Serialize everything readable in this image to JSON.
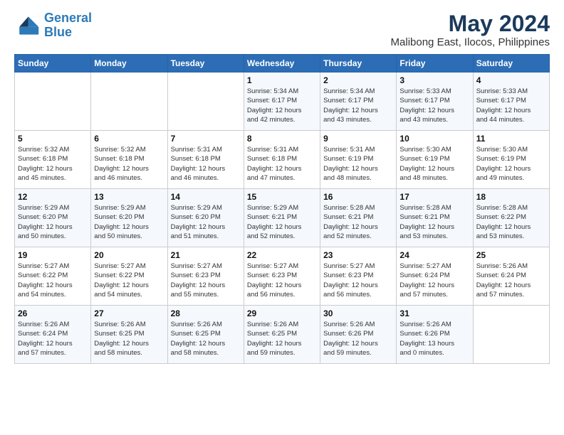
{
  "logo": {
    "line1": "General",
    "line2": "Blue"
  },
  "title": "May 2024",
  "subtitle": "Malibong East, Ilocos, Philippines",
  "weekdays": [
    "Sunday",
    "Monday",
    "Tuesday",
    "Wednesday",
    "Thursday",
    "Friday",
    "Saturday"
  ],
  "weeks": [
    [
      {
        "day": "",
        "info": ""
      },
      {
        "day": "",
        "info": ""
      },
      {
        "day": "",
        "info": ""
      },
      {
        "day": "1",
        "info": "Sunrise: 5:34 AM\nSunset: 6:17 PM\nDaylight: 12 hours\nand 42 minutes."
      },
      {
        "day": "2",
        "info": "Sunrise: 5:34 AM\nSunset: 6:17 PM\nDaylight: 12 hours\nand 43 minutes."
      },
      {
        "day": "3",
        "info": "Sunrise: 5:33 AM\nSunset: 6:17 PM\nDaylight: 12 hours\nand 43 minutes."
      },
      {
        "day": "4",
        "info": "Sunrise: 5:33 AM\nSunset: 6:17 PM\nDaylight: 12 hours\nand 44 minutes."
      }
    ],
    [
      {
        "day": "5",
        "info": "Sunrise: 5:32 AM\nSunset: 6:18 PM\nDaylight: 12 hours\nand 45 minutes."
      },
      {
        "day": "6",
        "info": "Sunrise: 5:32 AM\nSunset: 6:18 PM\nDaylight: 12 hours\nand 46 minutes."
      },
      {
        "day": "7",
        "info": "Sunrise: 5:31 AM\nSunset: 6:18 PM\nDaylight: 12 hours\nand 46 minutes."
      },
      {
        "day": "8",
        "info": "Sunrise: 5:31 AM\nSunset: 6:18 PM\nDaylight: 12 hours\nand 47 minutes."
      },
      {
        "day": "9",
        "info": "Sunrise: 5:31 AM\nSunset: 6:19 PM\nDaylight: 12 hours\nand 48 minutes."
      },
      {
        "day": "10",
        "info": "Sunrise: 5:30 AM\nSunset: 6:19 PM\nDaylight: 12 hours\nand 48 minutes."
      },
      {
        "day": "11",
        "info": "Sunrise: 5:30 AM\nSunset: 6:19 PM\nDaylight: 12 hours\nand 49 minutes."
      }
    ],
    [
      {
        "day": "12",
        "info": "Sunrise: 5:29 AM\nSunset: 6:20 PM\nDaylight: 12 hours\nand 50 minutes."
      },
      {
        "day": "13",
        "info": "Sunrise: 5:29 AM\nSunset: 6:20 PM\nDaylight: 12 hours\nand 50 minutes."
      },
      {
        "day": "14",
        "info": "Sunrise: 5:29 AM\nSunset: 6:20 PM\nDaylight: 12 hours\nand 51 minutes."
      },
      {
        "day": "15",
        "info": "Sunrise: 5:29 AM\nSunset: 6:21 PM\nDaylight: 12 hours\nand 52 minutes."
      },
      {
        "day": "16",
        "info": "Sunrise: 5:28 AM\nSunset: 6:21 PM\nDaylight: 12 hours\nand 52 minutes."
      },
      {
        "day": "17",
        "info": "Sunrise: 5:28 AM\nSunset: 6:21 PM\nDaylight: 12 hours\nand 53 minutes."
      },
      {
        "day": "18",
        "info": "Sunrise: 5:28 AM\nSunset: 6:22 PM\nDaylight: 12 hours\nand 53 minutes."
      }
    ],
    [
      {
        "day": "19",
        "info": "Sunrise: 5:27 AM\nSunset: 6:22 PM\nDaylight: 12 hours\nand 54 minutes."
      },
      {
        "day": "20",
        "info": "Sunrise: 5:27 AM\nSunset: 6:22 PM\nDaylight: 12 hours\nand 54 minutes."
      },
      {
        "day": "21",
        "info": "Sunrise: 5:27 AM\nSunset: 6:23 PM\nDaylight: 12 hours\nand 55 minutes."
      },
      {
        "day": "22",
        "info": "Sunrise: 5:27 AM\nSunset: 6:23 PM\nDaylight: 12 hours\nand 56 minutes."
      },
      {
        "day": "23",
        "info": "Sunrise: 5:27 AM\nSunset: 6:23 PM\nDaylight: 12 hours\nand 56 minutes."
      },
      {
        "day": "24",
        "info": "Sunrise: 5:27 AM\nSunset: 6:24 PM\nDaylight: 12 hours\nand 57 minutes."
      },
      {
        "day": "25",
        "info": "Sunrise: 5:26 AM\nSunset: 6:24 PM\nDaylight: 12 hours\nand 57 minutes."
      }
    ],
    [
      {
        "day": "26",
        "info": "Sunrise: 5:26 AM\nSunset: 6:24 PM\nDaylight: 12 hours\nand 57 minutes."
      },
      {
        "day": "27",
        "info": "Sunrise: 5:26 AM\nSunset: 6:25 PM\nDaylight: 12 hours\nand 58 minutes."
      },
      {
        "day": "28",
        "info": "Sunrise: 5:26 AM\nSunset: 6:25 PM\nDaylight: 12 hours\nand 58 minutes."
      },
      {
        "day": "29",
        "info": "Sunrise: 5:26 AM\nSunset: 6:25 PM\nDaylight: 12 hours\nand 59 minutes."
      },
      {
        "day": "30",
        "info": "Sunrise: 5:26 AM\nSunset: 6:26 PM\nDaylight: 12 hours\nand 59 minutes."
      },
      {
        "day": "31",
        "info": "Sunrise: 5:26 AM\nSunset: 6:26 PM\nDaylight: 13 hours\nand 0 minutes."
      },
      {
        "day": "",
        "info": ""
      }
    ]
  ]
}
